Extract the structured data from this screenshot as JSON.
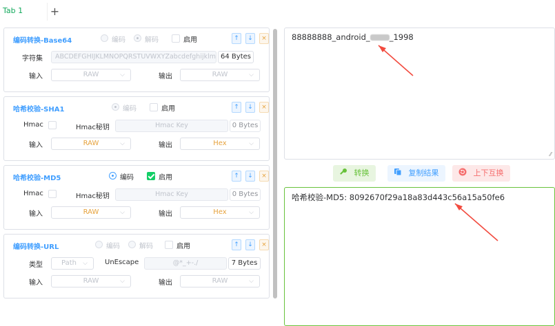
{
  "tabs": {
    "active_label": "Tab 1",
    "add_label": "+"
  },
  "panels": {
    "base64": {
      "title": "编码转换-Base64",
      "encode": "编码",
      "decode": "解码",
      "enable": "启用",
      "charset_label": "字符集",
      "charset_value": "ABCDEFGHIJKLMNOPQRSTUVWXYZabcdefghijklmnc",
      "charset_size": "64 Bytes",
      "input_label": "输入",
      "input_value": "RAW",
      "output_label": "输出",
      "output_value": "RAW"
    },
    "sha1": {
      "title": "哈希校验-SHA1",
      "encode": "编码",
      "enable": "启用",
      "hmac_label": "Hmac",
      "hmac_key_label": "Hmac秘钥",
      "hmac_key_placeholder": "Hmac Key",
      "hmac_key_size": "0 Bytes",
      "input_label": "输入",
      "input_value": "RAW",
      "output_label": "输出",
      "output_value": "Hex"
    },
    "md5": {
      "title": "哈希校验-MD5",
      "encode": "编码",
      "enable": "启用",
      "hmac_label": "Hmac",
      "hmac_key_label": "Hmac秘钥",
      "hmac_key_placeholder": "Hmac Key",
      "hmac_key_size": "0 Bytes",
      "input_label": "输入",
      "input_value": "RAW",
      "output_label": "输出",
      "output_value": "Hex"
    },
    "url": {
      "title": "编码转换-URL",
      "encode": "编码",
      "decode": "解码",
      "enable": "启用",
      "type_label": "类型",
      "type_value": "Path",
      "unescape_label": "UnEscape",
      "unescape_value": "@*_+-./",
      "unescape_size": "7 Bytes",
      "input_label": "输入",
      "input_value": "RAW",
      "output_label": "输出",
      "output_value": "RAW"
    },
    "buttons": {
      "up": "↑",
      "down": "↓",
      "close": "×"
    }
  },
  "input_area": {
    "text_start": "88888888_android_",
    "text_end": "_1998"
  },
  "actions": {
    "convert": "转换",
    "copy": "复制结果",
    "swap": "上下互换"
  },
  "output_area": {
    "text": "哈希校验-MD5: 8092670f29a18a83d443c56a15a50fe6"
  },
  "colors": {
    "accent": "#409eff",
    "success": "#13ce66",
    "annotation_arrow": "#f24b3f"
  }
}
